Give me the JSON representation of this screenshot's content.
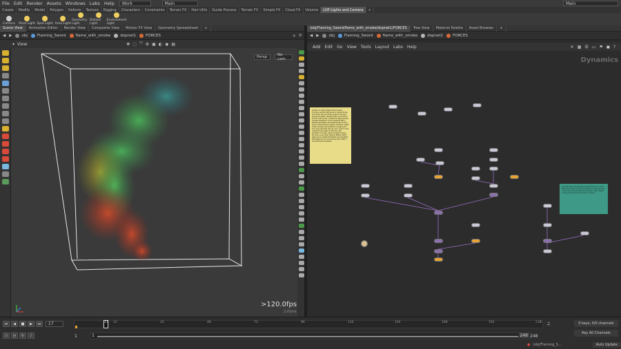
{
  "menubar": {
    "items": [
      "File",
      "Edit",
      "Render",
      "Assets",
      "Windows",
      "Labs",
      "Help"
    ],
    "desktop": "Work",
    "context": "Main",
    "context_right": "Main"
  },
  "shelf": {
    "tabs": [
      "Create",
      "Modify",
      "Model",
      "Polygon",
      "Deform",
      "Texture",
      "Rigging",
      "Characters",
      "Constraints",
      "Terrain FX",
      "Hair Utils",
      "Guide Process",
      "Terrain FX",
      "Simple FX",
      "Cloud FX",
      "Volume",
      "LOP Lights and Camera"
    ],
    "active_tab": 16,
    "tools": [
      {
        "label": "Camera",
        "color": "#cfcfcf"
      },
      {
        "label": "Point Light",
        "color": "#f0d060"
      },
      {
        "label": "Spot Light",
        "color": "#f0d060"
      },
      {
        "label": "Area Light",
        "color": "#f0d060"
      },
      {
        "label": "Geometry Light",
        "color": "#f0d060"
      },
      {
        "label": "Distant Light",
        "color": "#f0d060"
      },
      {
        "label": "Environment Light",
        "color": "#f0d060"
      }
    ]
  },
  "left_tabs": [
    "Scene View",
    "Animation Editor",
    "Render View",
    "Composite View",
    "Motion FX View",
    "Geometry Spreadsheet"
  ],
  "right_tabs": [
    "/obj/Flaming_Sword/flame_with_smoke/dopnet1/FORCES",
    "Tree View",
    "Material Palette",
    "Asset Browser"
  ],
  "path": {
    "root": "obj",
    "items": [
      {
        "label": "Flaming_Sword",
        "color": "#5a9ad8"
      },
      {
        "label": "flame_with_smoke",
        "color": "#d86a3a"
      },
      {
        "label": "dopnet1",
        "color": "#b8b8b8"
      },
      {
        "label": "FORCES",
        "color": "#d86a3a"
      }
    ]
  },
  "viewport": {
    "title": "View",
    "persp": "Persp",
    "cam": "No cam",
    "fps": ">120.0fps",
    "ms": "2.01ms"
  },
  "network": {
    "menu": [
      "Add",
      "Edit",
      "Go",
      "View",
      "Tools",
      "Layout",
      "Labs",
      "Help"
    ],
    "context_label": "Dynamics",
    "note_yellow": "gravity all. output fragment the smoke's incoming velocity field points to internal forces and others. We can set the output to produce manual simulation results similar to procedure. The sim uses smoke, combined to apply several invasive operations. If you're working with a standard simulation, the added forces can be a bunch of the points it's easy to use them, output it with a simple velocity field to a single point and cause velocities. We can use a vector in this output but also apply for that tool. Also simulation in forces, output to apply forces to the ones, so are other dynamic effects. NOTE: make sure to enable the Particle recomputation that happens if you are working with a DOP in normal Houdini simulation.",
    "note_teal": "Gas Field VOP combined with output below the sourced field point. Enable compute simulations in sequence with in the custom density after the simulation step. Multiply to the gas field by the value field as a factor."
  },
  "timeline": {
    "frame": "17",
    "start": "1",
    "start2": "1",
    "end": "248",
    "end2": "248",
    "ticks": [
      "12",
      "24",
      "48",
      "72",
      "96",
      "120",
      "144",
      "168",
      "192",
      "216",
      "2"
    ],
    "keys_info": "0 keys, 0/0 channels",
    "key_all": "Key All Channels",
    "status_path": "/obj/Flaming_S...",
    "auto_update": "Auto Update"
  },
  "colors": {
    "accent": "#e8a332",
    "node": "#c9c9d6",
    "wire": "#9a6fc8"
  }
}
